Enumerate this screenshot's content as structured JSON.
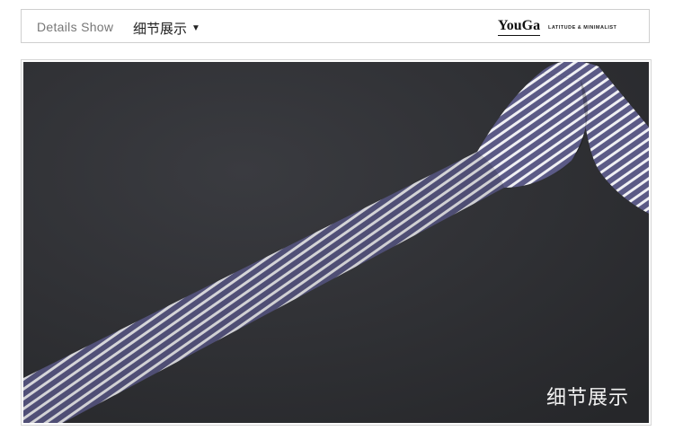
{
  "header": {
    "title_en": "Details Show",
    "title_cn": "细节展示",
    "dropdown_arrow": "▼",
    "brand": "YouGa",
    "tagline": "LATITUDE & MINIMALIST"
  },
  "photo": {
    "caption": "细节展示",
    "image_subject": "striped-necktie",
    "colors": {
      "background": "#2e2f33",
      "tie_stripe_dark": "#5b5a86",
      "tie_stripe_light": "#f0f0f4"
    }
  }
}
